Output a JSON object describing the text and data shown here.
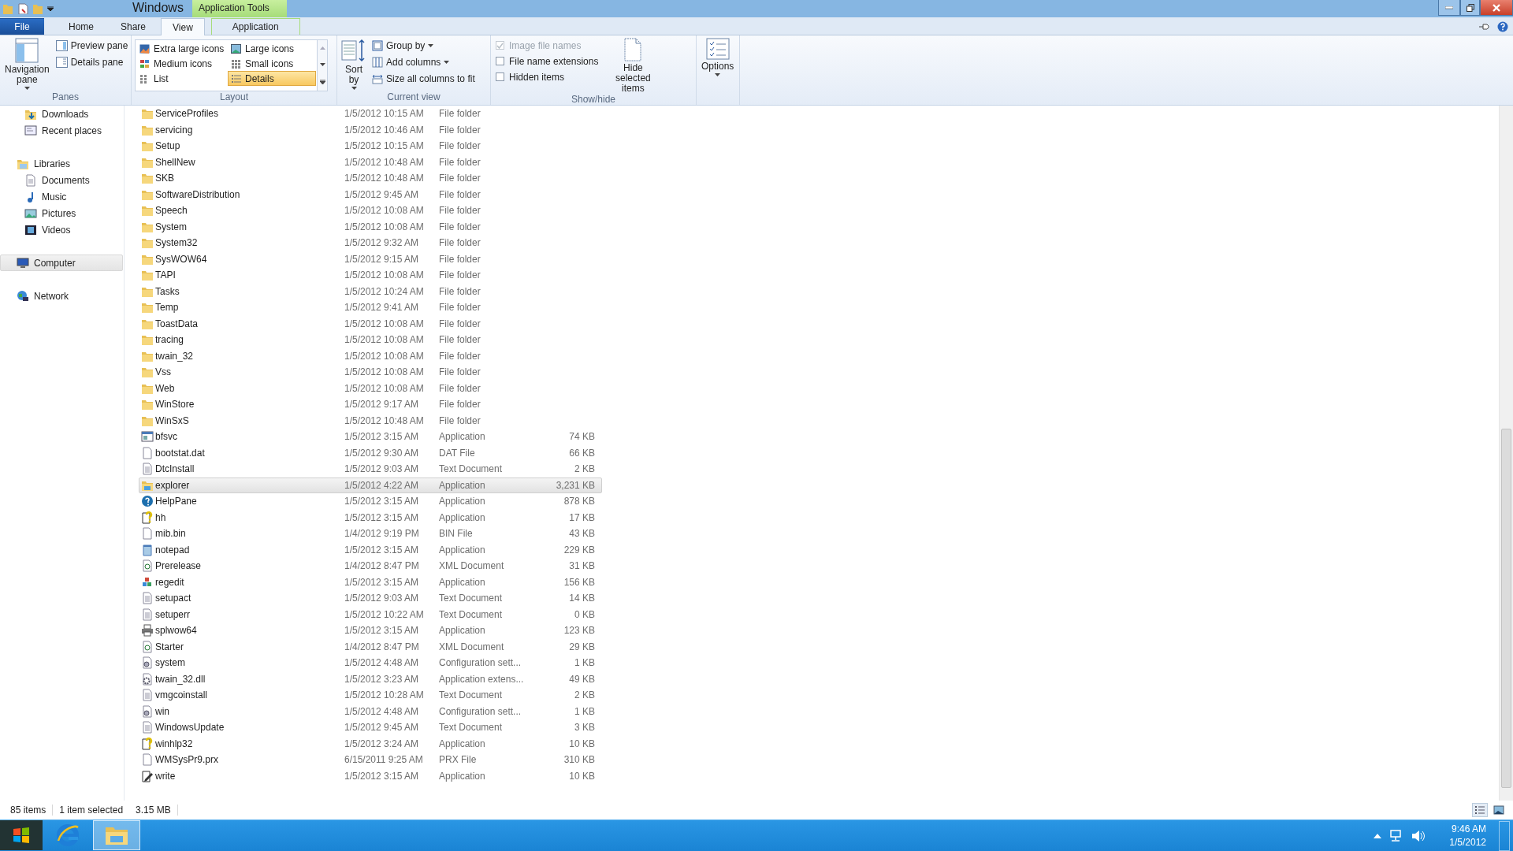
{
  "window": {
    "title": "Windows",
    "contextual_header": "Application Tools"
  },
  "ribbon": {
    "tabs": [
      {
        "label": "File",
        "kind": "file",
        "selected": false
      },
      {
        "label": "Home",
        "kind": "normal",
        "selected": false
      },
      {
        "label": "Share",
        "kind": "normal",
        "selected": false
      },
      {
        "label": "View",
        "kind": "normal",
        "selected": true
      },
      {
        "label": "Application",
        "kind": "contextual",
        "selected": false
      }
    ],
    "panes": {
      "label": "Panes",
      "navigation_pane": "Navigation pane",
      "buttons": [
        "Preview pane",
        "Details pane"
      ]
    },
    "layout": {
      "label": "Layout",
      "items": [
        {
          "label": "Extra large icons",
          "selected": false
        },
        {
          "label": "Large icons",
          "selected": false
        },
        {
          "label": "Medium icons",
          "selected": false
        },
        {
          "label": "Small icons",
          "selected": false
        },
        {
          "label": "List",
          "selected": false
        },
        {
          "label": "Details",
          "selected": true
        }
      ]
    },
    "current_view": {
      "label": "Current view",
      "sort": "Sort by",
      "buttons": [
        {
          "label": "Group by",
          "dropdown": true
        },
        {
          "label": "Add columns",
          "dropdown": true
        },
        {
          "label": "Size all columns to fit",
          "dropdown": false
        }
      ]
    },
    "show_hide": {
      "label": "Show/hide",
      "checkboxes": [
        {
          "label": "Image file names",
          "checked": true,
          "disabled": true
        },
        {
          "label": "File name extensions",
          "checked": false,
          "disabled": false
        },
        {
          "label": "Hidden items",
          "checked": false,
          "disabled": false
        }
      ],
      "hide_selected": "Hide selected items"
    },
    "options_button": "Options"
  },
  "sidebar": {
    "continued_items": [
      {
        "label": "Downloads",
        "kind": "downloads",
        "selected": false
      },
      {
        "label": "Recent places",
        "kind": "recent",
        "selected": false
      }
    ],
    "items": [
      {
        "label": "Libraries",
        "kind": "libraries",
        "selected": false,
        "children": [
          {
            "label": "Documents",
            "kind": "documents",
            "selected": false
          },
          {
            "label": "Music",
            "kind": "music",
            "selected": false
          },
          {
            "label": "Pictures",
            "kind": "pictures",
            "selected": false
          },
          {
            "label": "Videos",
            "kind": "videos",
            "selected": false
          }
        ]
      },
      {
        "label": "Computer",
        "kind": "computer",
        "selected": true
      },
      {
        "label": "Network",
        "kind": "network",
        "selected": false
      }
    ]
  },
  "files": [
    {
      "name": "ServiceProfiles",
      "date": "1/5/2012 10:15 AM",
      "type": "File folder",
      "kind": "folder",
      "selected": false
    },
    {
      "name": "servicing",
      "date": "1/5/2012 10:46 AM",
      "type": "File folder",
      "kind": "folder",
      "selected": false
    },
    {
      "name": "Setup",
      "date": "1/5/2012 10:15 AM",
      "type": "File folder",
      "kind": "folder",
      "selected": false
    },
    {
      "name": "ShellNew",
      "date": "1/5/2012 10:48 AM",
      "type": "File folder",
      "kind": "folder",
      "selected": false
    },
    {
      "name": "SKB",
      "date": "1/5/2012 10:48 AM",
      "type": "File folder",
      "kind": "folder",
      "selected": false
    },
    {
      "name": "SoftwareDistribution",
      "date": "1/5/2012 9:45 AM",
      "type": "File folder",
      "kind": "folder",
      "selected": false
    },
    {
      "name": "Speech",
      "date": "1/5/2012 10:08 AM",
      "type": "File folder",
      "kind": "folder",
      "selected": false
    },
    {
      "name": "System",
      "date": "1/5/2012 10:08 AM",
      "type": "File folder",
      "kind": "folder",
      "selected": false
    },
    {
      "name": "System32",
      "date": "1/5/2012 9:32 AM",
      "type": "File folder",
      "kind": "folder",
      "selected": false
    },
    {
      "name": "SysWOW64",
      "date": "1/5/2012 9:15 AM",
      "type": "File folder",
      "kind": "folder",
      "selected": false
    },
    {
      "name": "TAPI",
      "date": "1/5/2012 10:08 AM",
      "type": "File folder",
      "kind": "folder",
      "selected": false
    },
    {
      "name": "Tasks",
      "date": "1/5/2012 10:24 AM",
      "type": "File folder",
      "kind": "folder",
      "selected": false
    },
    {
      "name": "Temp",
      "date": "1/5/2012 9:41 AM",
      "type": "File folder",
      "kind": "folder",
      "selected": false
    },
    {
      "name": "ToastData",
      "date": "1/5/2012 10:08 AM",
      "type": "File folder",
      "kind": "folder",
      "selected": false
    },
    {
      "name": "tracing",
      "date": "1/5/2012 10:08 AM",
      "type": "File folder",
      "kind": "folder",
      "selected": false
    },
    {
      "name": "twain_32",
      "date": "1/5/2012 10:08 AM",
      "type": "File folder",
      "kind": "folder",
      "selected": false
    },
    {
      "name": "Vss",
      "date": "1/5/2012 10:08 AM",
      "type": "File folder",
      "kind": "folder",
      "selected": false
    },
    {
      "name": "Web",
      "date": "1/5/2012 10:08 AM",
      "type": "File folder",
      "kind": "folder",
      "selected": false
    },
    {
      "name": "WinStore",
      "date": "1/5/2012 9:17 AM",
      "type": "File folder",
      "kind": "folder",
      "selected": false
    },
    {
      "name": "WinSxS",
      "date": "1/5/2012 10:48 AM",
      "type": "File folder",
      "kind": "folder",
      "selected": false
    },
    {
      "name": "bfsvc",
      "date": "1/5/2012 3:15 AM",
      "type": "Application",
      "size": "74 KB",
      "kind": "app",
      "selected": false
    },
    {
      "name": "bootstat.dat",
      "date": "1/5/2012 9:30 AM",
      "type": "DAT File",
      "size": "66 KB",
      "kind": "blank",
      "selected": false
    },
    {
      "name": "DtcInstall",
      "date": "1/5/2012 9:03 AM",
      "type": "Text Document",
      "size": "2 KB",
      "kind": "text",
      "selected": false
    },
    {
      "name": "explorer",
      "date": "1/5/2012 4:22 AM",
      "type": "Application",
      "size": "3,231 KB",
      "kind": "explorer",
      "selected": true
    },
    {
      "name": "HelpPane",
      "date": "1/5/2012 3:15 AM",
      "type": "Application",
      "size": "878 KB",
      "kind": "help",
      "selected": false
    },
    {
      "name": "hh",
      "date": "1/5/2012 3:15 AM",
      "type": "Application",
      "size": "17 KB",
      "kind": "helpdoc",
      "selected": false
    },
    {
      "name": "mib.bin",
      "date": "1/4/2012 9:19 PM",
      "type": "BIN File",
      "size": "43 KB",
      "kind": "blank",
      "selected": false
    },
    {
      "name": "notepad",
      "date": "1/5/2012 3:15 AM",
      "type": "Application",
      "size": "229 KB",
      "kind": "notepad",
      "selected": false
    },
    {
      "name": "Prerelease",
      "date": "1/4/2012 8:47 PM",
      "type": "XML Document",
      "size": "31 KB",
      "kind": "xml",
      "selected": false
    },
    {
      "name": "regedit",
      "date": "1/5/2012 3:15 AM",
      "type": "Application",
      "size": "156 KB",
      "kind": "regedit",
      "selected": false
    },
    {
      "name": "setupact",
      "date": "1/5/2012 9:03 AM",
      "type": "Text Document",
      "size": "14 KB",
      "kind": "text",
      "selected": false
    },
    {
      "name": "setuperr",
      "date": "1/5/2012 10:22 AM",
      "type": "Text Document",
      "size": "0 KB",
      "kind": "text",
      "selected": false
    },
    {
      "name": "splwow64",
      "date": "1/5/2012 3:15 AM",
      "type": "Application",
      "size": "123 KB",
      "kind": "printer",
      "selected": false
    },
    {
      "name": "Starter",
      "date": "1/4/2012 8:47 PM",
      "type": "XML Document",
      "size": "29 KB",
      "kind": "xml",
      "selected": false
    },
    {
      "name": "system",
      "date": "1/5/2012 4:48 AM",
      "type": "Configuration sett...",
      "size": "1 KB",
      "kind": "config",
      "selected": false
    },
    {
      "name": "twain_32.dll",
      "date": "1/5/2012 3:23 AM",
      "type": "Application extens...",
      "size": "49 KB",
      "kind": "dll",
      "selected": false
    },
    {
      "name": "vmgcoinstall",
      "date": "1/5/2012 10:28 AM",
      "type": "Text Document",
      "size": "2 KB",
      "kind": "text",
      "selected": false
    },
    {
      "name": "win",
      "date": "1/5/2012 4:48 AM",
      "type": "Configuration sett...",
      "size": "1 KB",
      "kind": "config",
      "selected": false
    },
    {
      "name": "WindowsUpdate",
      "date": "1/5/2012 9:45 AM",
      "type": "Text Document",
      "size": "3 KB",
      "kind": "text",
      "selected": false
    },
    {
      "name": "winhlp32",
      "date": "1/5/2012 3:24 AM",
      "type": "Application",
      "size": "10 KB",
      "kind": "helpdoc",
      "selected": false
    },
    {
      "name": "WMSysPr9.prx",
      "date": "6/15/2011 9:25 AM",
      "type": "PRX File",
      "size": "310 KB",
      "kind": "blank",
      "selected": false
    },
    {
      "name": "write",
      "date": "1/5/2012 3:15 AM",
      "type": "Application",
      "size": "10 KB",
      "kind": "write",
      "selected": false
    }
  ],
  "status_bar": {
    "item_count": "85 items",
    "selection": "1 item selected",
    "selection_size": "3.15 MB",
    "views": [
      {
        "kind": "details",
        "selected": true
      },
      {
        "kind": "large_icons",
        "selected": false
      }
    ]
  },
  "taskbar": {
    "items": [
      {
        "kind": "start",
        "active": false
      },
      {
        "kind": "browser",
        "active": false
      },
      {
        "kind": "explorer",
        "active": true
      }
    ],
    "clock_time": "9:46 AM",
    "clock_date": "1/5/2012"
  }
}
